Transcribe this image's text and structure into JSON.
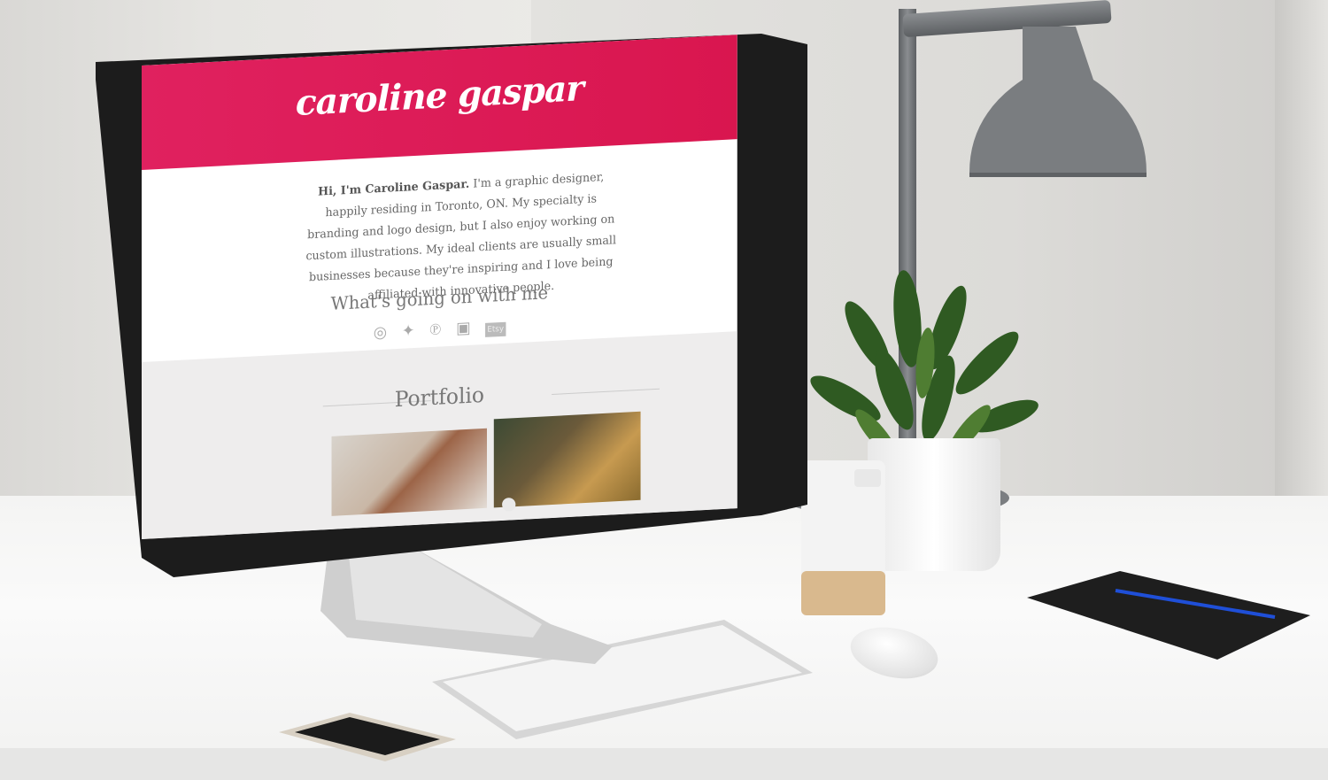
{
  "site": {
    "logo": "caroline gaspar",
    "intro_name": "Hi, I'm Caroline Gaspar.",
    "intro_text": "I'm a graphic designer, happily residing in Toronto, ON. My specialty is branding and logo design, but I also enjoy working on custom illustrations. My ideal clients are usually small businesses because they're inspiring and I love being affiliated with innovative people.",
    "social_heading": "What's going on with me",
    "social_links": [
      {
        "icon": "dribbble-icon",
        "glyph": "◎"
      },
      {
        "icon": "twitter-icon",
        "glyph": "✦"
      },
      {
        "icon": "pinterest-icon",
        "glyph": "℗"
      },
      {
        "icon": "instagram-icon",
        "glyph": "▣"
      },
      {
        "icon": "etsy-icon",
        "glyph": "Etsy"
      }
    ],
    "portfolio_heading": "Portfolio",
    "accent_color": "#e0215f"
  }
}
